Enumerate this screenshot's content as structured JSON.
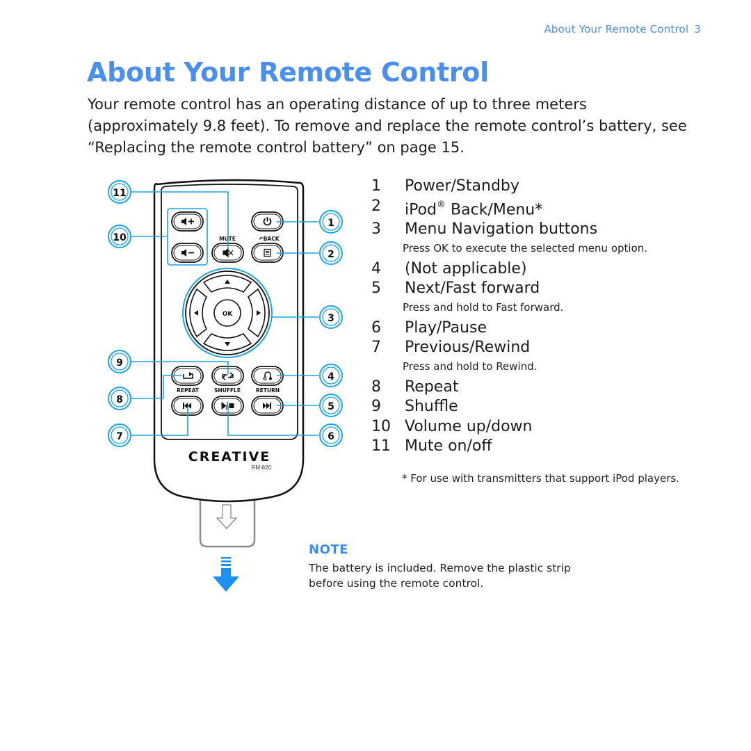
{
  "header": {
    "running_title": "About Your Remote Control",
    "page_number": "3"
  },
  "title": "About Your Remote Control",
  "intro": "Your remote control has an operating distance of up to three meters (approximately 9.8 feet). To remove and replace the remote control’s battery, see “Replacing the remote control battery” on page 15.",
  "remote": {
    "brand": "CREATIVE",
    "model": "RM-820",
    "button_labels": {
      "mute": "MUTE",
      "back": "BACK",
      "ok": "OK",
      "repeat": "REPEAT",
      "shuffle": "SHUFFLE",
      "return": "RETURN"
    },
    "callouts": [
      "1",
      "2",
      "3",
      "4",
      "5",
      "6",
      "7",
      "8",
      "9",
      "10",
      "11"
    ],
    "callout_color": "#1aa3e8"
  },
  "legend": {
    "items": [
      {
        "num": "1",
        "label": "Power/Standby"
      },
      {
        "num": "2",
        "label_pre": "iPod",
        "label_sup": "®",
        "label_post": " Back/Menu*"
      },
      {
        "num": "3",
        "label": "Menu Navigation buttons",
        "sub": "Press OK to execute the selected menu option."
      },
      {
        "num": "4",
        "label": "(Not applicable)"
      },
      {
        "num": "5",
        "label": "Next/Fast forward",
        "sub": "Press and hold to Fast forward."
      },
      {
        "num": "6",
        "label": "Play/Pause"
      },
      {
        "num": "7",
        "label": "Previous/Rewind",
        "sub": "Press and hold to Rewind."
      },
      {
        "num": "8",
        "label": "Repeat"
      },
      {
        "num": "9",
        "label": "Shuffle"
      },
      {
        "num": "10",
        "label": "Volume up/down"
      },
      {
        "num": "11",
        "label": "Mute on/off"
      }
    ],
    "footnote": "* For use with transmitters that support iPod players."
  },
  "note": {
    "heading": "NOTE",
    "body": "The battery is included. Remove the plastic strip before using the remote control."
  },
  "colors": {
    "title_blue": "#4a8ef0",
    "callout_blue": "#1aa3e8",
    "arrow_blue": "#1e90f0"
  }
}
